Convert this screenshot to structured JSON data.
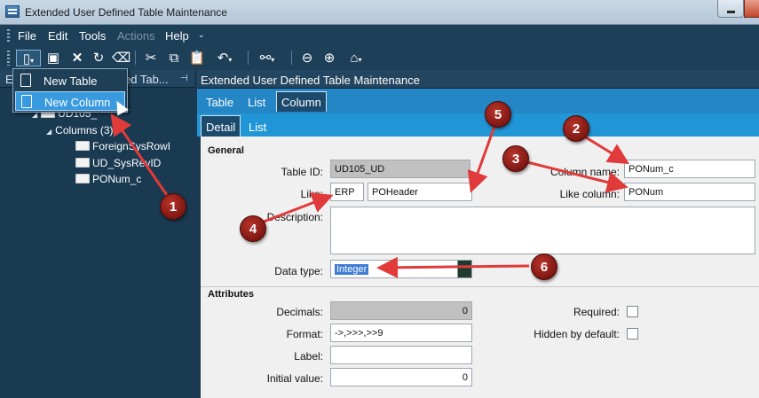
{
  "window": {
    "title": "Extended User Defined Table Maintenance"
  },
  "menu": {
    "items": [
      "File",
      "Edit",
      "Tools",
      "Actions",
      "Help"
    ],
    "more": "⌄"
  },
  "toolbar": {
    "icons": [
      "new-icon",
      "save-icon",
      "delete-icon",
      "refresh-icon",
      "clear-icon",
      "cut-icon",
      "copy-icon",
      "paste-icon",
      "undo-icon",
      "search-icon",
      "back-icon",
      "forward-icon",
      "home-icon"
    ]
  },
  "new_menu": {
    "items": [
      "New Table",
      "New Column"
    ],
    "hovered": "New Column"
  },
  "tree": {
    "header_lead": "E",
    "header": "ed Tab...",
    "nodes": [
      {
        "label": "UD105_",
        "level": 1,
        "expanded": true
      },
      {
        "label": "Columns (3)",
        "level": 2,
        "expanded": true
      },
      {
        "label": "ForeignSysRowI",
        "level": 3
      },
      {
        "label": "UD_SysRevID",
        "level": 3
      },
      {
        "label": "PONum_c",
        "level": 3,
        "selected": true
      }
    ]
  },
  "panel": {
    "title": "Extended User Defined Table Maintenance",
    "tabs": [
      "Table",
      "List",
      "Column"
    ],
    "active_tab": "Column",
    "subtabs": [
      "Detail",
      "List"
    ],
    "active_subtab": "Detail"
  },
  "general": {
    "section": "General",
    "table_id": {
      "label": "Table ID:",
      "value": "UD105_UD"
    },
    "like": {
      "label": "Like:",
      "value1": "ERP",
      "value2": "POHeader"
    },
    "column_name": {
      "label": "Column name:",
      "value": "PONum_c"
    },
    "like_column": {
      "label": "Like column:",
      "value": "PONum"
    },
    "description": {
      "label": "Description:",
      "value": ""
    },
    "data_type": {
      "label": "Data type:",
      "value": "Integer"
    }
  },
  "attributes": {
    "section": "Attributes",
    "decimals": {
      "label": "Decimals:",
      "value": "0"
    },
    "format": {
      "label": "Format:",
      "value": "->,>>>,>>9"
    },
    "label": {
      "label": "Label:",
      "value": ""
    },
    "initial_value": {
      "label": "Initial value:",
      "value": "0"
    },
    "required": {
      "label": "Required:",
      "checked": false
    },
    "hidden_by_default": {
      "label": "Hidden by default:",
      "checked": false
    }
  },
  "callouts": [
    "1",
    "2",
    "3",
    "4",
    "5",
    "6"
  ],
  "colors": {
    "callout": "#a32a20",
    "arrow": "#e03a3a",
    "accent": "#2196d7"
  }
}
